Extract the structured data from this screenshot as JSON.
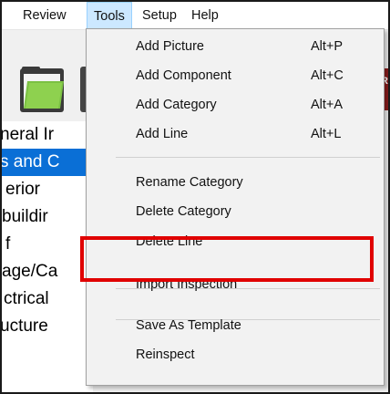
{
  "menubar": {
    "items": [
      {
        "label": "Review"
      },
      {
        "label": "Tools"
      },
      {
        "label": "Setup"
      },
      {
        "label": "Help"
      }
    ]
  },
  "toolbar": {
    "icons": [
      "folder-icon",
      "toolbar-icon",
      "app-icon"
    ],
    "red_icon_glyph": "R"
  },
  "categories": [
    {
      "label": "neral Ir"
    },
    {
      "label": "s and C",
      "selected": true
    },
    {
      "label": "erior"
    },
    {
      "label": "buildir"
    },
    {
      "label": "f"
    },
    {
      "label": "age/Ca"
    },
    {
      "label": "ctrical"
    },
    {
      "label": "ucture"
    }
  ],
  "tools_menu": {
    "items": [
      {
        "label": "Add Picture",
        "shortcut": "Alt+P"
      },
      {
        "label": "Add Component",
        "shortcut": "Alt+C"
      },
      {
        "label": "Add Category",
        "shortcut": "Alt+A"
      },
      {
        "label": "Add Line",
        "shortcut": "Alt+L"
      },
      {
        "label": "Rename Category"
      },
      {
        "label": "Delete Category"
      },
      {
        "label": "Delete Line",
        "highlighted": true
      },
      {
        "label": "Import Inspection"
      },
      {
        "label": "Save As Template"
      },
      {
        "label": "Reinspect"
      }
    ]
  },
  "colors": {
    "highlight_box": "#e00000",
    "selection": "#0a6fd6",
    "active_menu": "#cce8ff"
  }
}
